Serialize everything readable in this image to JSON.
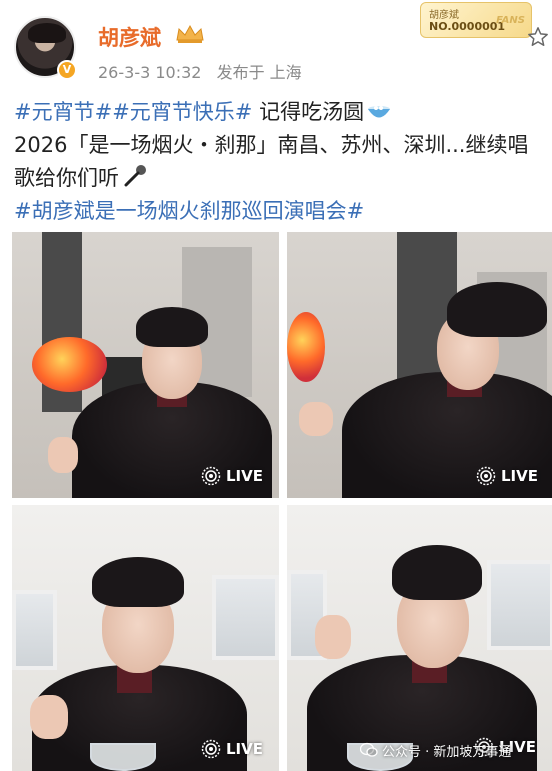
{
  "post": {
    "username": "胡彦斌",
    "timestamp": "26-3-3 10:32",
    "source": "发布于 上海",
    "fans_badge": {
      "name": "胡彦斌",
      "number": "NO.0000001",
      "label": "FANS"
    },
    "text": {
      "line1_tags": "#元宵节##元宵节快乐#",
      "line1_rest": " 记得吃汤圆",
      "line2": "2026「是一场烟火・刹那」南昌、苏州、深圳...继续唱歌给你们听",
      "line3_tag": "#胡彦斌是一场烟火刹那巡回演唱会#"
    }
  },
  "photos": [
    {
      "live_label": "LIVE"
    },
    {
      "live_label": "LIVE"
    },
    {
      "live_label": "LIVE"
    },
    {
      "live_label": "LIVE"
    }
  ],
  "watermark": "公众号 · 新加坡万事通",
  "icons": {
    "verified": "verified-v-icon",
    "crown": "crown-icon",
    "favorite": "star-outline-icon",
    "bowl": "soup-bowl-emoji",
    "mic": "microphone-emoji",
    "live": "live-photo-icon",
    "wechat": "wechat-icon"
  },
  "colors": {
    "username": "#e86b2a",
    "hashtag": "#3b6fb6",
    "meta": "#8a8a8a"
  }
}
